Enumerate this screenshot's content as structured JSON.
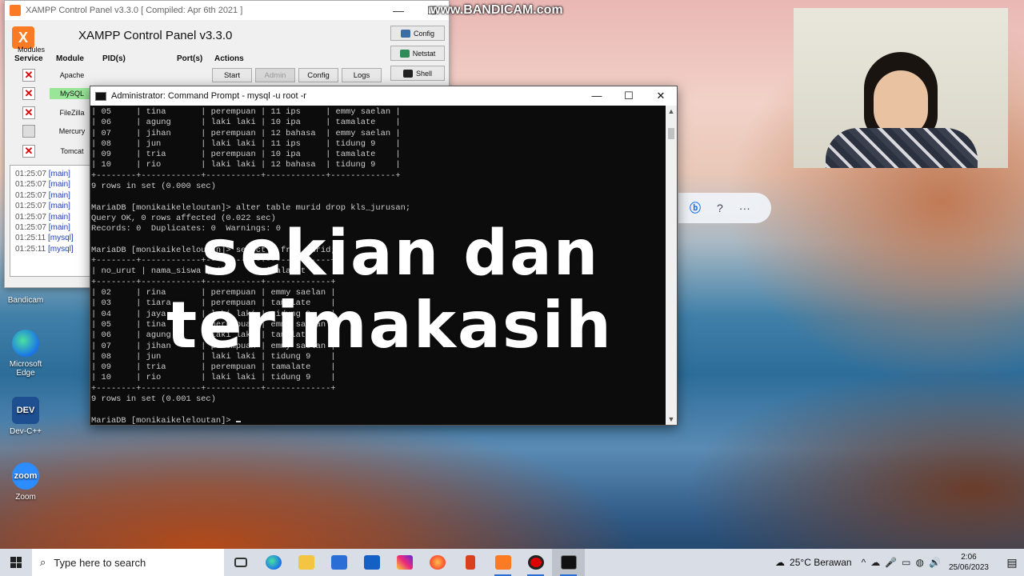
{
  "watermark": "www.BANDICAM.com",
  "desktop_icons": [
    {
      "label": "Bandicam"
    },
    {
      "label": "Microsoft Edge"
    },
    {
      "label": "Dev-C++",
      "glyph": "DEV"
    },
    {
      "label": "Zoom",
      "glyph": "zoom"
    }
  ],
  "xampp": {
    "title": "XAMPP Control Panel v3.3.0   [ Compiled: Apr 6th 2021 ]",
    "heading": "XAMPP Control Panel v3.3.0",
    "modules_label": "Modules",
    "columns": {
      "service": "Service",
      "module": "Module",
      "pids": "PID(s)",
      "ports": "Port(s)",
      "actions": "Actions"
    },
    "right_buttons": {
      "config": "Config",
      "netstat": "Netstat",
      "shell": "Shell"
    },
    "action_buttons": {
      "start": "Start",
      "admin": "Admin",
      "config": "Config",
      "logs": "Logs"
    },
    "services": [
      {
        "name": "Apache",
        "state": "stopped"
      },
      {
        "name": "MySQL",
        "state": "running"
      },
      {
        "name": "FileZilla",
        "state": "stopped"
      },
      {
        "name": "Mercury",
        "state": "none"
      },
      {
        "name": "Tomcat",
        "state": "stopped"
      }
    ],
    "log": [
      {
        "time": "01:25:07",
        "module": "[main]"
      },
      {
        "time": "01:25:07",
        "module": "[main]"
      },
      {
        "time": "01:25:07",
        "module": "[main]"
      },
      {
        "time": "01:25:07",
        "module": "[main]"
      },
      {
        "time": "01:25:07",
        "module": "[main]"
      },
      {
        "time": "01:25:07",
        "module": "[main]"
      },
      {
        "time": "01:25:11",
        "module": "[mysql]"
      },
      {
        "time": "01:25:11",
        "module": "[mysql]"
      }
    ]
  },
  "cmd": {
    "title": "Administrator: Command Prompt - mysql  -u root -r",
    "lines": [
      "| 05     | tina       | perempuan | 11 ips     | emmy saelan |",
      "| 06     | agung      | laki laki | 10 ipa     | tamalate    |",
      "| 07     | jihan      | perempuan | 12 bahasa  | emmy saelan |",
      "| 08     | jun        | laki laki | 11 ips     | tidung 9    |",
      "| 09     | tria       | perempuan | 10 ipa     | tamalate    |",
      "| 10     | rio        | laki laki | 12 bahasa  | tidung 9    |",
      "+--------+------------+-----------+------------+-------------+",
      "9 rows in set (0.000 sec)",
      "",
      "MariaDB [monikaikeleloutan]> alter table murid drop kls_jurusan;",
      "Query OK, 0 rows affected (0.022 sec)",
      "Records: 0  Duplicates: 0  Warnings: 0",
      "",
      "MariaDB [monikaikeleloutan]> select * from murid;",
      "+--------+------------+-----------+-------------+",
      "| no_urut | nama_siswa | jk        | alamat      |",
      "+--------+------------+-----------+-------------+",
      "| 02     | rina       | perempuan | emmy saelan |",
      "| 03     | tiara      | perempuan | tamalate    |",
      "| 04     | jaya       | laki laki | tidung 9    |",
      "| 05     | tina       | perempuan | emmy saelan |",
      "| 06     | agung      | laki laki | tamalate    |",
      "| 07     | jihan      | perempuan | emmy saelan |",
      "| 08     | jun        | laki laki | tidung 9    |",
      "| 09     | tria       | perempuan | tamalate    |",
      "| 10     | rio        | laki laki | tidung 9    |",
      "+--------+------------+-----------+-------------+",
      "9 rows in set (0.001 sec)",
      ""
    ],
    "prompt": "MariaDB [monikaikeleloutan]> "
  },
  "caption": {
    "line1": "sekian dan",
    "line2": "terimakasih"
  },
  "taskbar": {
    "search_placeholder": "Type here to search",
    "weather": "25°C  Berawan",
    "time": "2:06",
    "date": "25/06/2023"
  }
}
